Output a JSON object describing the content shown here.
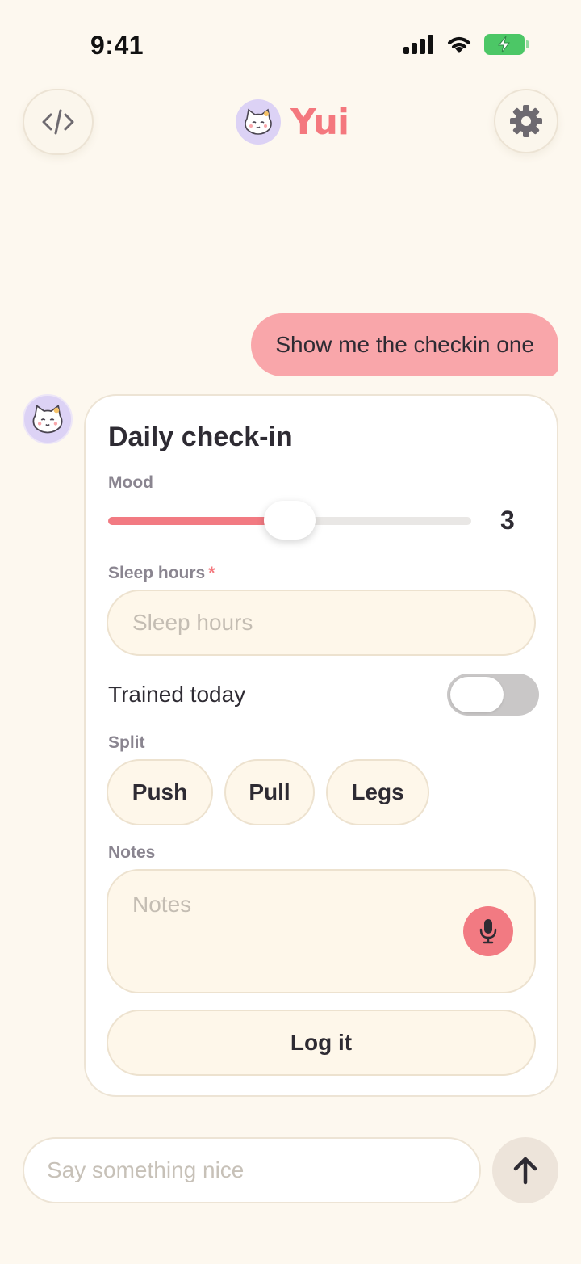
{
  "status_bar": {
    "time": "9:41"
  },
  "header": {
    "code_button_icon": "code-icon",
    "settings_button_icon": "gear-icon",
    "logo_text": "Yui"
  },
  "chat": {
    "user_message": "Show me the checkin one",
    "checkin_card": {
      "title": "Daily check-in",
      "mood": {
        "label": "Mood",
        "value": "3",
        "fraction": 0.5
      },
      "sleep": {
        "label": "Sleep hours",
        "required_mark": "*",
        "placeholder": "Sleep hours"
      },
      "trained": {
        "label": "Trained today",
        "on": false
      },
      "split": {
        "label": "Split",
        "options": [
          "Push",
          "Pull",
          "Legs"
        ]
      },
      "notes": {
        "label": "Notes",
        "placeholder": "Notes"
      },
      "submit_label": "Log it"
    }
  },
  "composer": {
    "placeholder": "Say something nice"
  },
  "colors": {
    "accent": "#F27A82",
    "user_bubble": "#F9A6AA",
    "background": "#FDF8EF",
    "battery": "#4CC766"
  }
}
